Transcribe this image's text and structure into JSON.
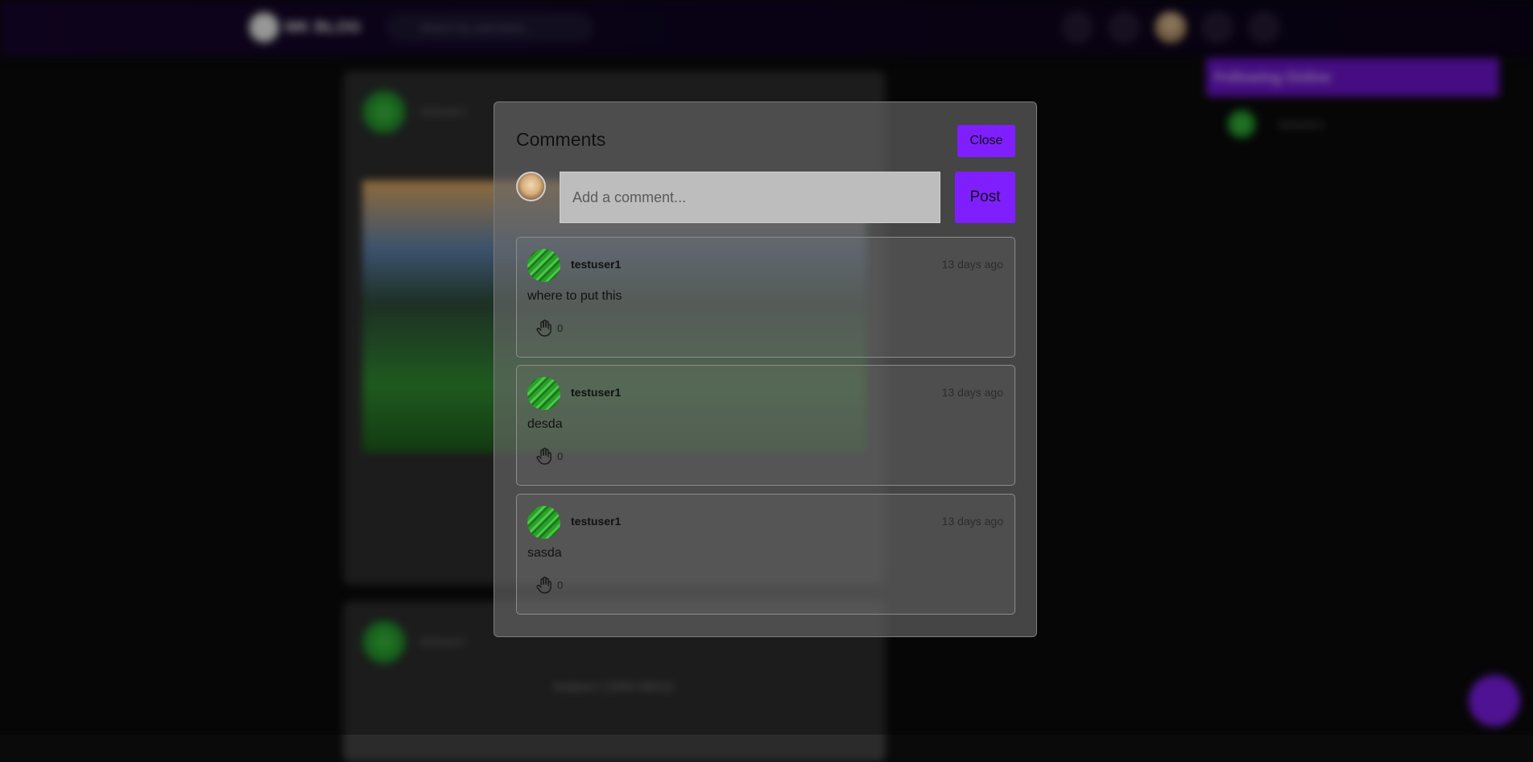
{
  "background": {
    "logo_text": "MK BLOG",
    "search_placeholder": "Search by username...",
    "post1": {
      "author": "testuser1"
    },
    "post2": {
      "author": "testuser1",
      "caption": "testpost 2 (2000-06012)"
    },
    "following": {
      "title": "Following Online",
      "user": "testuser1"
    }
  },
  "modal": {
    "title": "Comments",
    "close_label": "Close",
    "input_placeholder": "Add a comment...",
    "post_label": "Post",
    "comments": [
      {
        "author": "testuser1",
        "time": "13 days ago",
        "text": "where to put this",
        "likes": "0"
      },
      {
        "author": "testuser1",
        "time": "13 days ago",
        "text": "desda",
        "likes": "0"
      },
      {
        "author": "testuser1",
        "time": "13 days ago",
        "text": "sasda",
        "likes": "0"
      }
    ]
  },
  "colors": {
    "accent": "#7f1fff",
    "modal_bg": "#6c6c6c",
    "page_bg": "#0a0a0a"
  },
  "icons": {
    "like": "hand-icon",
    "user": "avatar"
  }
}
